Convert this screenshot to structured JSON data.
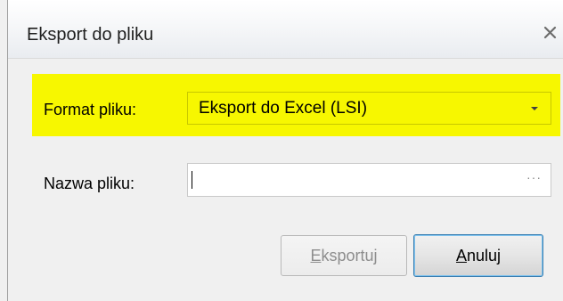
{
  "window": {
    "title": "Eksport do pliku"
  },
  "form": {
    "format_label": "Format pliku:",
    "format_value": "Eksport do Excel (LSI)",
    "name_label": "Nazwa pliku:",
    "name_value": "",
    "browse_glyph": "···"
  },
  "buttons": {
    "export": {
      "mnemonic": "E",
      "rest": "ksportuj",
      "enabled": false
    },
    "cancel": {
      "mnemonic": "A",
      "rest": "nuluj",
      "enabled": true
    }
  },
  "colors": {
    "highlight": "#f7f700",
    "focus_border": "#3c7fb1"
  },
  "icons": {
    "close": "close-icon",
    "dropdown": "chevron-down-icon"
  }
}
